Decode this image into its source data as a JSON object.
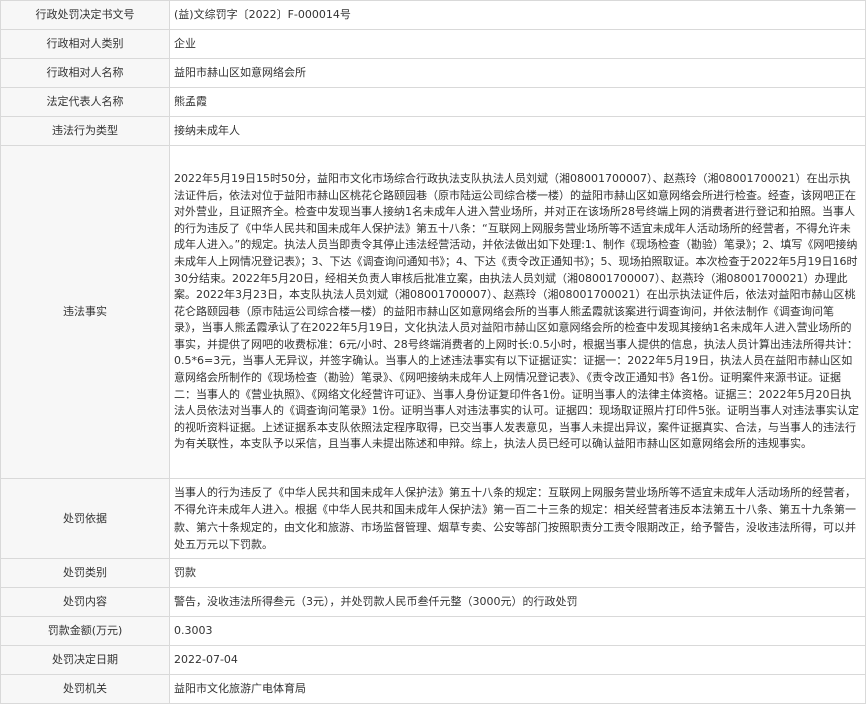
{
  "rows": [
    {
      "label": "行政处罚决定书文号",
      "value": "(益)文综罚字〔2022〕F-000014号"
    },
    {
      "label": "行政相对人类别",
      "value": "企业"
    },
    {
      "label": "行政相对人名称",
      "value": "益阳市赫山区如意网络会所"
    },
    {
      "label": "法定代表人名称",
      "value": "熊孟霞"
    },
    {
      "label": "违法行为类型",
      "value": "接纳未成年人"
    },
    {
      "label": "违法事实",
      "value": "2022年5月19日15时50分，益阳市文化市场综合行政执法支队执法人员刘斌（湘08001700007）、赵燕玲（湘08001700021）在出示执法证件后，依法对位于益阳市赫山区桃花仑路颐园巷（原市陆运公司综合楼一楼）的益阳市赫山区如意网络会所进行检查。经查，该网吧正在对外营业，且证照齐全。检查中发现当事人接纳1名未成年人进入营业场所，并对正在该场所28号终端上网的消费者进行登记和拍照。当事人的行为违反了《中华人民共和国未成年人保护法》第五十八条：“互联网上网服务营业场所等不适宜未成年人活动场所的经营者，不得允许未成年人进入。”的规定。执法人员当即责令其停止违法经营活动，并依法做出如下处理:1、制作《现场检查（勘验）笔录》；2、填写《网吧接纳未成年人上网情况登记表》；3、下达《调查询问通知书》；4、下达《责令改正通知书》；5、现场拍照取证。本次检查于2022年5月19日16时30分结束。2022年5月20日，经相关负责人审核后批准立案，由执法人员刘斌（湘08001700007）、赵燕玲（湘08001700021）办理此案。2022年3月23日，本支队执法人员刘斌（湘08001700007）、赵燕玲（湘08001700021）在出示执法证件后，依法对益阳市赫山区桃花仑路颐园巷（原市陆运公司综合楼一楼）的益阳市赫山区如意网络会所的当事人熊孟霞就该案进行调查询问，并依法制作《调查询问笔录》，当事人熊孟霞承认了在2022年5月19日，文化执法人员对益阳市赫山区如意网络会所的检查中发现其接纳1名未成年人进入营业场所的事实，并提供了网吧的收费标准：6元/小时、28号终端消费者的上网时长:0.5小时，根据当事人提供的信息，执法人员计算出违法所得共计：0.5*6=3元，当事人无异议，并签字确认。当事人的上述违法事实有以下证据证实：证据一：2022年5月19日，执法人员在益阳市赫山区如意网络会所制作的《现场检查（勘验）笔录》、《网吧接纳未成年人上网情况登记表》、《责令改正通知书》各1份。证明案件来源书证。证据二：当事人的《营业执照》、《网络文化经营许可证》、当事人身份证复印件各1份。证明当事人的法律主体资格。证据三：2022年5月20日执法人员依法对当事人的《调查询问笔录》1份。证明当事人对违法事实的认可。证据四：现场取证照片打印件5张。证明当事人对违法事实认定的视听资料证据。上述证据系本支队依照法定程序取得，已交当事人发表意见，当事人未提出异议，案件证据真实、合法，与当事人的违法行为有关联性，本支队予以采信，且当事人未提出陈述和申辩。综上，执法人员已经可以确认益阳市赫山区如意网络会所的违规事实。"
    },
    {
      "label": "处罚依据",
      "value": "当事人的行为违反了《中华人民共和国未成年人保护法》第五十八条的规定：互联网上网服务营业场所等不适宜未成年人活动场所的经营者，不得允许未成年人进入。根据《中华人民共和国未成年人保护法》第一百二十三条的规定：相关经营者违反本法第五十八条、第五十九条第一款、第六十条规定的，由文化和旅游、市场监督管理、烟草专卖、公安等部门按照职责分工责令限期改正，给予警告，没收违法所得，可以并处五万元以下罚款。"
    },
    {
      "label": "处罚类别",
      "value": "罚款"
    },
    {
      "label": "处罚内容",
      "value": "警告，没收违法所得叁元（3元），并处罚款人民币叁仟元整（3000元）的行政处罚"
    },
    {
      "label": "罚款金额(万元)",
      "value": "0.3003"
    },
    {
      "label": "处罚决定日期",
      "value": "2022-07-04"
    },
    {
      "label": "处罚机关",
      "value": "益阳市文化旅游广电体育局"
    }
  ]
}
